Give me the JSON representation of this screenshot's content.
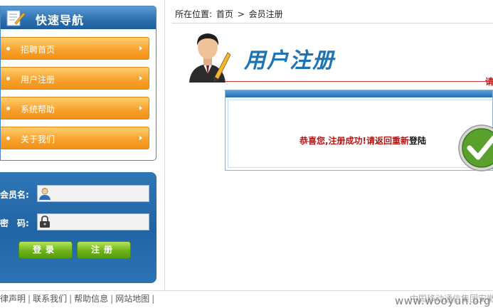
{
  "nav": {
    "title": "快速导航",
    "items": [
      {
        "label": "招聘首页"
      },
      {
        "label": "用户注册"
      },
      {
        "label": "系统帮助"
      },
      {
        "label": "关于我们"
      }
    ]
  },
  "login": {
    "username_label": "会员名:",
    "password_label": "密　码:",
    "username_value": "",
    "password_value": "",
    "login_button": "登录",
    "register_button": "注册"
  },
  "breadcrumb": {
    "prefix": "所在位置:",
    "home": "首页",
    "separator": ">",
    "current": "会员注册"
  },
  "page": {
    "heading": "用户注册",
    "hint": "请"
  },
  "message": {
    "text": "恭喜您,注册成功!请返回重新",
    "link": "登陆"
  },
  "footer": {
    "links": [
      "法律声明",
      "联系我们",
      "帮助信息",
      "网站地图"
    ],
    "copyright": "中国移动通信集团安徽"
  },
  "watermark": "www.wooyun.org",
  "colors": {
    "nav_blue": "#2c6eae",
    "nav_item_orange": "#f8a22f",
    "button_green": "#6cb31a",
    "title_blue": "#1d73b4",
    "message_red": "#b01616"
  },
  "icons": {
    "nav_header": "document-pencil-icon",
    "username_field": "user-icon",
    "password_field": "lock-icon",
    "avatar": "businessman-pencil-icon",
    "success": "check-icon"
  }
}
